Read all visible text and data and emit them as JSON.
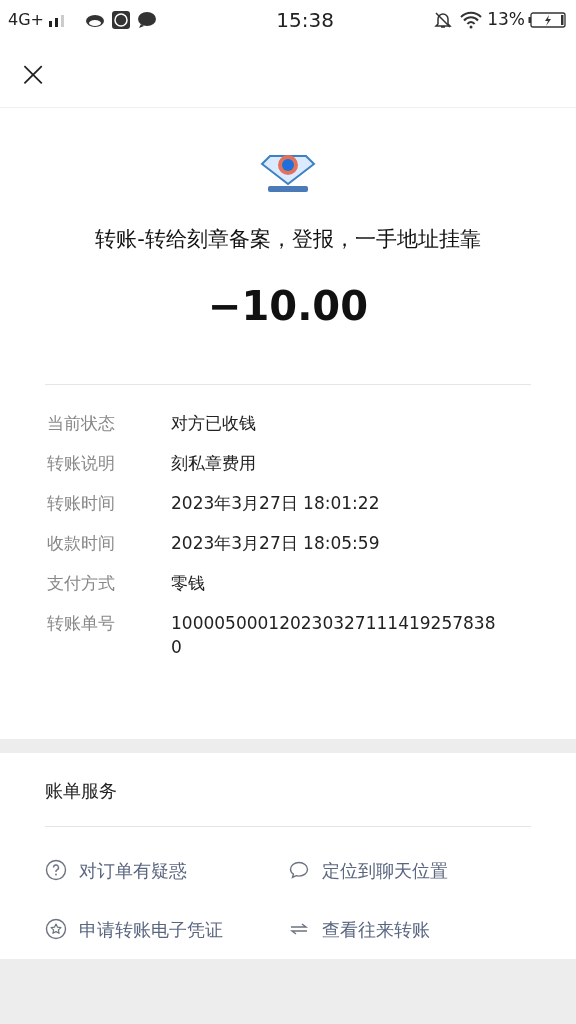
{
  "status_bar": {
    "network": "4G+",
    "time": "15:38",
    "battery": "13%"
  },
  "header": {
    "close": "×"
  },
  "title": "转账-转给刻章备案，登报，一手地址挂靠",
  "amount": "−10.00",
  "details": [
    {
      "label": "当前状态",
      "value": "对方已收钱"
    },
    {
      "label": "转账说明",
      "value": "刻私章费用"
    },
    {
      "label": "转账时间",
      "value": "2023年3月27日 18:01:22"
    },
    {
      "label": "收款时间",
      "value": "2023年3月27日 18:05:59"
    },
    {
      "label": "支付方式",
      "value": "零钱"
    },
    {
      "label": "转账单号",
      "value": "1000050001202303271114192578380"
    }
  ],
  "services": {
    "title": "账单服务",
    "items": [
      {
        "kind": "question",
        "label": "对订单有疑惑"
      },
      {
        "kind": "chat",
        "label": "定位到聊天位置"
      },
      {
        "kind": "star",
        "label": "申请转账电子凭证"
      },
      {
        "kind": "swap",
        "label": "查看往来转账"
      }
    ]
  }
}
